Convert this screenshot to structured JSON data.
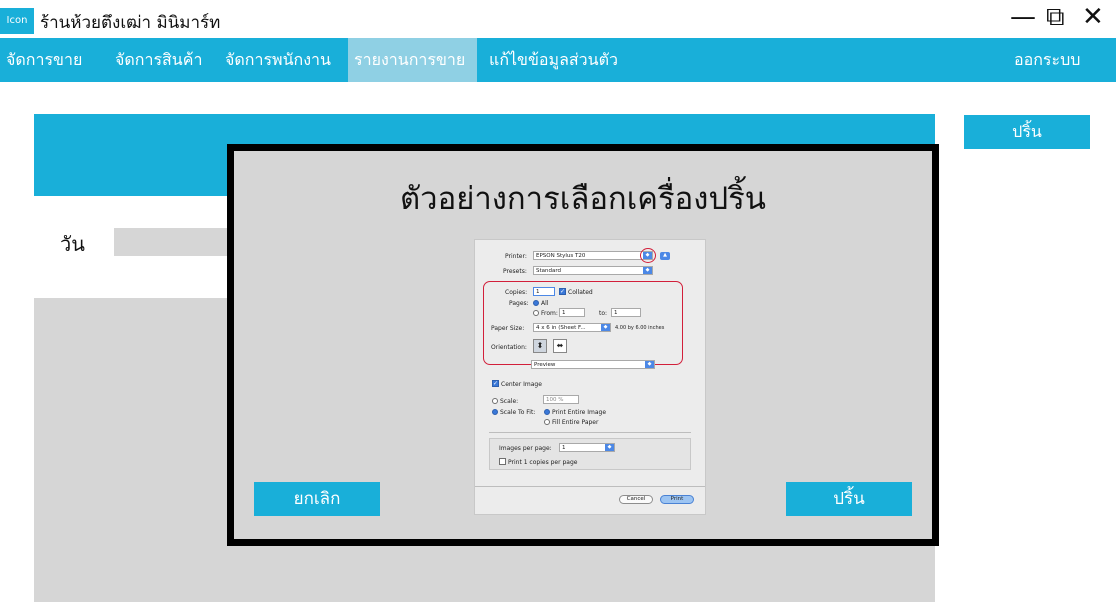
{
  "titlebar": {
    "icon_text": "Icon",
    "title": "ร้านห้วยตึงเฒ่า มินิมาร์ท",
    "minimize": "—",
    "restore": "⧉",
    "close": "✕"
  },
  "nav": {
    "items": [
      {
        "label": "จัดการขาย",
        "active": false
      },
      {
        "label": "จัดการสินค้า",
        "active": false
      },
      {
        "label": "จัดการพนักงาน",
        "active": false
      },
      {
        "label": "รายงานการขาย",
        "active": true
      },
      {
        "label": "แก้ไขข้อมูลส่วนตัว",
        "active": false
      }
    ],
    "logout": "ออกระบบ"
  },
  "side_print_button": "ปริ้น",
  "filter": {
    "day_label": "วัน"
  },
  "modal": {
    "title": "ตัวอย่างการเลือกเครื่องปริ้น",
    "cancel": "ยกเลิก",
    "print": "ปริ้น"
  },
  "print_dialog": {
    "printer_label": "Printer:",
    "printer_value": "EPSON Stylus T20",
    "presets_label": "Presets:",
    "presets_value": "Standard",
    "copies_label": "Copies:",
    "copies_value": "1",
    "collated": "Collated",
    "pages_label": "Pages:",
    "pages_all": "All",
    "pages_from": "From:",
    "from_value": "1",
    "to_label": "to:",
    "to_value": "1",
    "paper_size_label": "Paper Size:",
    "paper_size_value": "4 x 6 in (Sheet F...",
    "paper_size_dims": "4.00 by 6.00 inches",
    "orientation_label": "Orientation:",
    "section_value": "Preview",
    "center_image": "Center Image",
    "scale_label": "Scale:",
    "scale_value": "100 %",
    "scale_to_fit": "Scale To Fit:",
    "print_entire_image": "Print Entire Image",
    "fill_entire_paper": "Fill Entire Paper",
    "images_per_page_label": "Images per page:",
    "images_per_page_value": "1",
    "print_copies_per_page": "Print 1 copies per page",
    "cancel": "Cancel",
    "print": "Print"
  },
  "colors": {
    "accent": "#19afd9",
    "nav_active": "#8fd0e4",
    "panel_gray": "#d6d6d6",
    "highlight_red": "#d21f3a"
  }
}
